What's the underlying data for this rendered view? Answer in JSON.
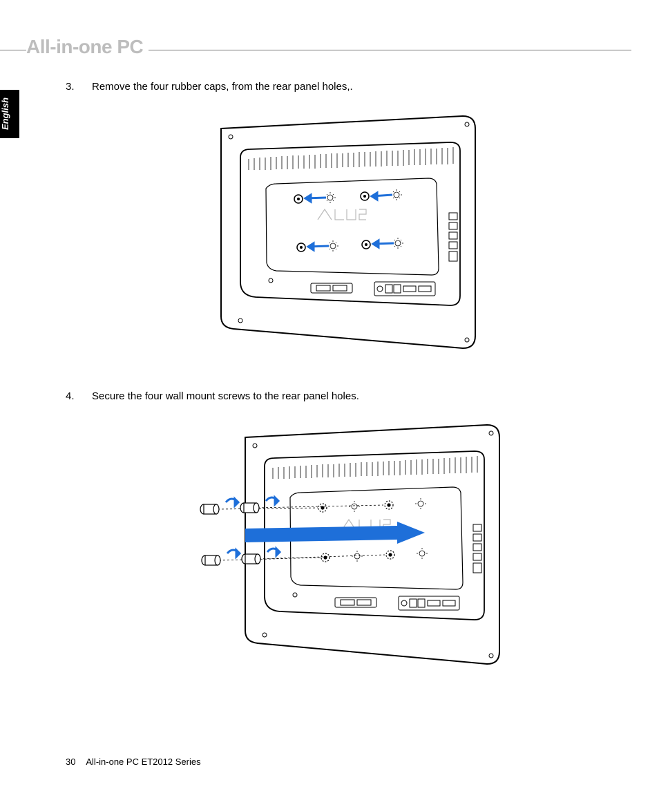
{
  "header": {
    "title": "All-in-one PC"
  },
  "language_tab": "English",
  "steps": [
    {
      "number": "3.",
      "text": "Remove the four rubber caps, from the rear panel holes,."
    },
    {
      "number": "4.",
      "text": "Secure the four wall mount screws to the rear panel holes."
    }
  ],
  "footer": {
    "page_number": "30",
    "doc_title": "All-in-one PC ET2012 Series"
  },
  "figures": {
    "fig1_alt": "Rear panel with four rubber caps and removal arrows",
    "fig2_alt": "Rear panel with four wall mount screws being inserted"
  }
}
